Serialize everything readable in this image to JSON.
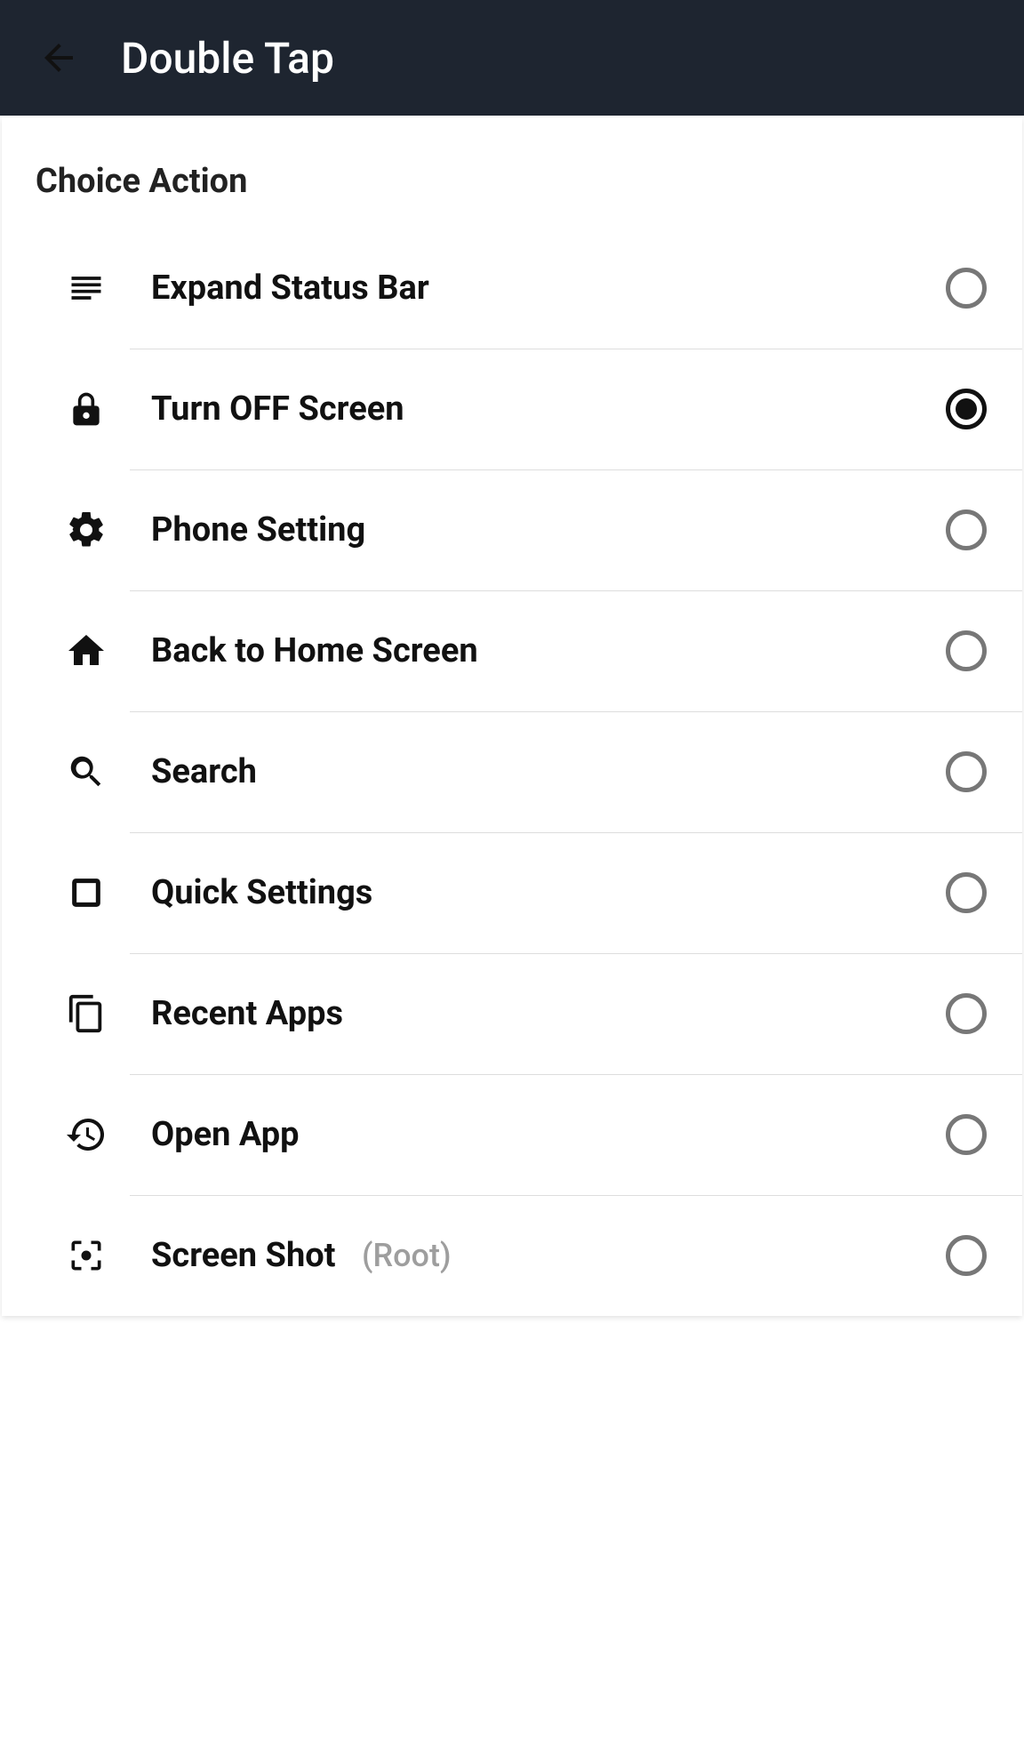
{
  "header": {
    "title": "Double Tap"
  },
  "section_title": "Choice Action",
  "selected_index": 1,
  "items": [
    {
      "label": "Expand Status Bar",
      "icon": "subject-icon",
      "note": ""
    },
    {
      "label": "Turn OFF Screen",
      "icon": "lock-icon",
      "note": ""
    },
    {
      "label": "Phone Setting",
      "icon": "gear-icon",
      "note": ""
    },
    {
      "label": "Back to Home Screen",
      "icon": "home-icon",
      "note": ""
    },
    {
      "label": "Search",
      "icon": "search-icon",
      "note": ""
    },
    {
      "label": "Quick Settings",
      "icon": "square-icon",
      "note": ""
    },
    {
      "label": "Recent Apps",
      "icon": "copy-icon",
      "note": ""
    },
    {
      "label": "Open App",
      "icon": "restore-icon",
      "note": ""
    },
    {
      "label": "Screen Shot",
      "icon": "center-focus-icon",
      "note": "(Root)"
    }
  ]
}
